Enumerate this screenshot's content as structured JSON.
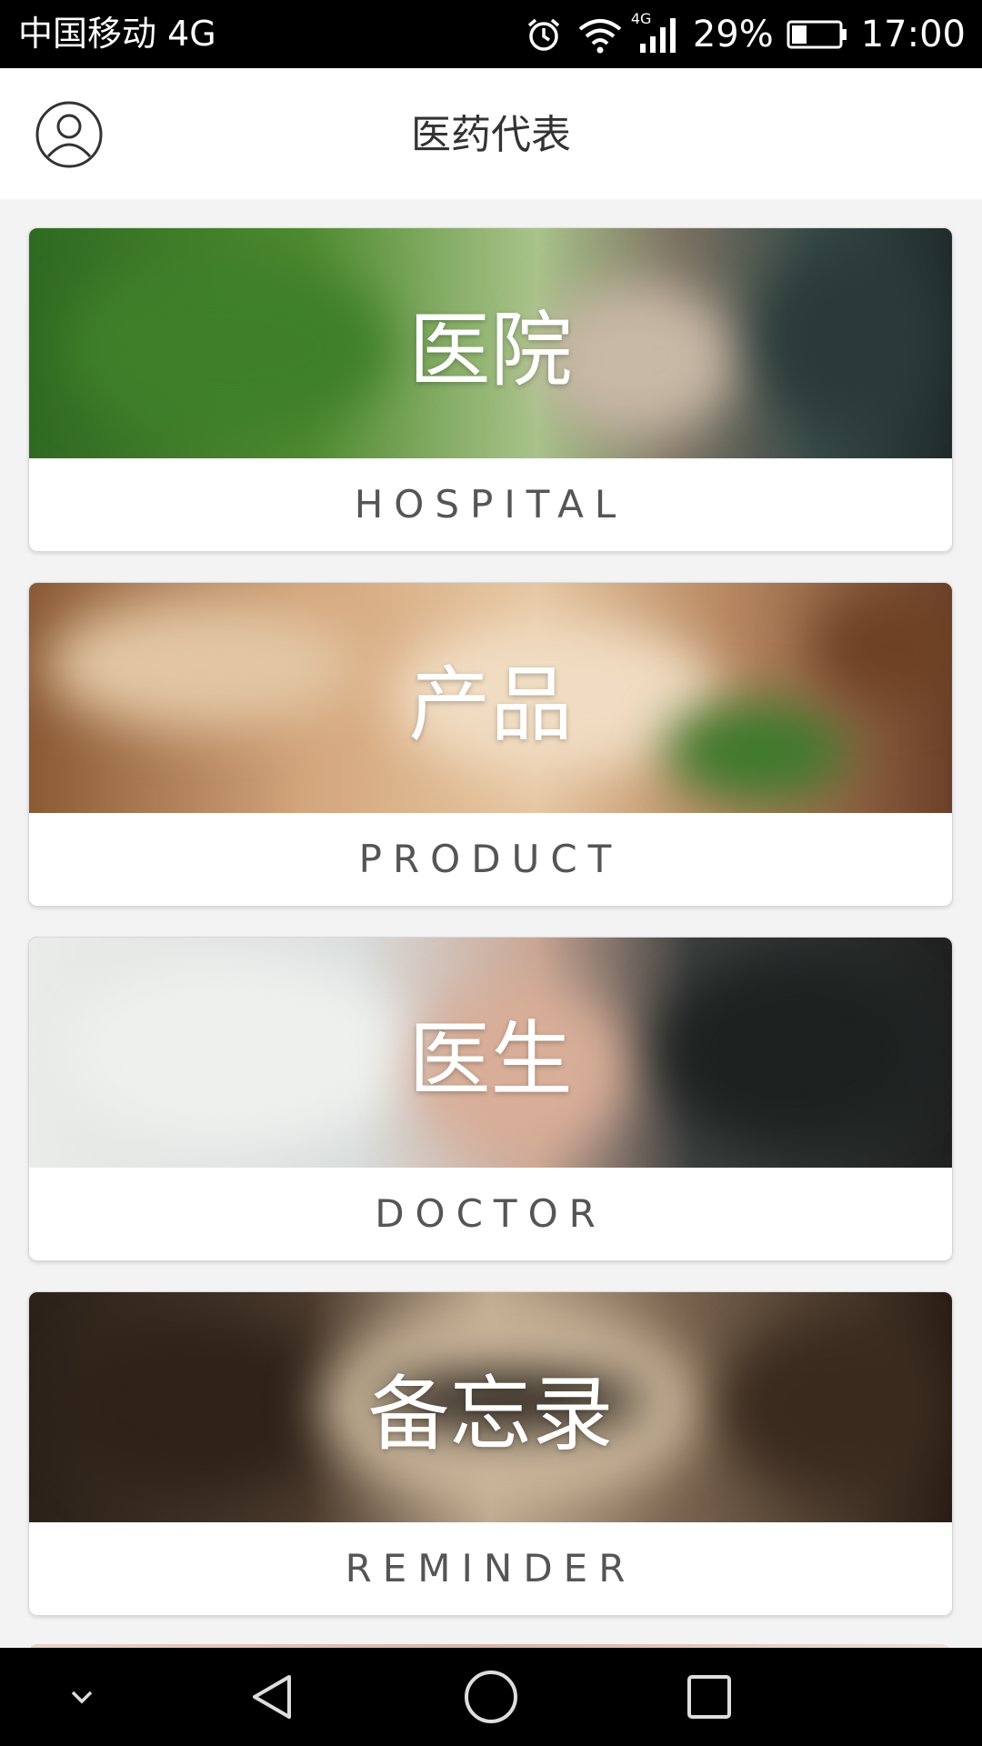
{
  "status_bar": {
    "carrier": "中国移动 4G",
    "network_badge": "4G",
    "battery_percent": "29%",
    "time": "17:00",
    "icons": [
      "alarm-icon",
      "wifi-icon",
      "signal-icon",
      "battery-icon"
    ]
  },
  "header": {
    "title": "医药代表",
    "avatar_icon": "user-avatar-icon"
  },
  "cards": [
    {
      "cn": "医院",
      "en": "HOSPITAL"
    },
    {
      "cn": "产品",
      "en": "PRODUCT"
    },
    {
      "cn": "医生",
      "en": "DOCTOR"
    },
    {
      "cn": "备忘录",
      "en": "REMINDER"
    }
  ],
  "nav_bar": {
    "icons": [
      "chevron-down-icon",
      "back-icon",
      "home-icon",
      "recents-icon"
    ]
  }
}
